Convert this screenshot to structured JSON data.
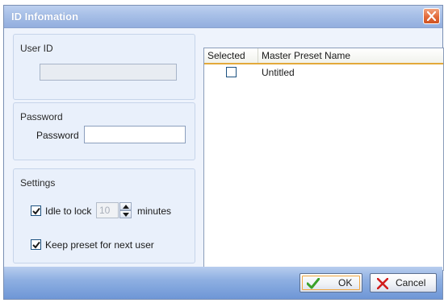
{
  "window": {
    "title": "ID Infomation"
  },
  "user_id": {
    "group_label": "User ID",
    "value": ""
  },
  "password": {
    "group_label": "Password",
    "field_label": "Password",
    "value": ""
  },
  "settings": {
    "group_label": "Settings",
    "idle_lock": {
      "checked": true,
      "label": "Idle to lock",
      "value": "10",
      "unit": "minutes"
    },
    "keep_preset": {
      "checked": true,
      "label": "Keep preset for next user"
    }
  },
  "preset_list": {
    "columns": [
      "Selected",
      "Master Preset Name"
    ],
    "rows": [
      {
        "selected": false,
        "name": "Untitled"
      }
    ]
  },
  "buttons": {
    "ok": "OK",
    "cancel": "Cancel"
  },
  "colors": {
    "accent_orange": "#e3a93a",
    "check_green": "#3aa12a",
    "cancel_red": "#d11c1c"
  }
}
